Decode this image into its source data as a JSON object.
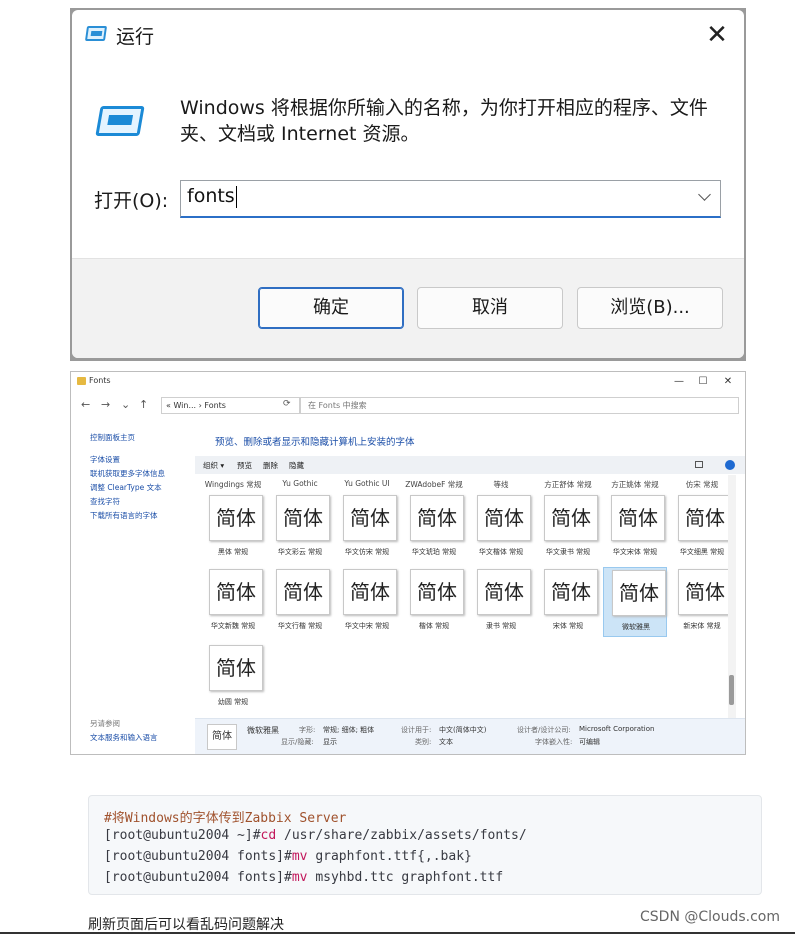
{
  "run_dialog": {
    "title": "运行",
    "close_glyph": "✕",
    "description": "Windows 将根据你所输入的名称，为你打开相应的程序、文件夹、文档或 Internet 资源。",
    "open_label": "打开(O):",
    "input_value": "fonts",
    "ok_label": "确定",
    "cancel_label": "取消",
    "browse_label": "浏览(B)...",
    "accent_color": "#2f6ec2"
  },
  "explorer": {
    "title": "Fonts",
    "window_buttons": [
      "—",
      "☐",
      "✕"
    ],
    "nav": {
      "back": "←",
      "forward": "→",
      "down": "⌄",
      "up": "↑",
      "refresh": "⟳"
    },
    "address": "« Win... › Fonts",
    "search_placeholder": "在 Fonts 中搜索",
    "left_links": [
      "控制面板主页",
      "字体设置",
      "联机获取更多字体信息",
      "调整 ClearType 文本",
      "查找字符",
      "下载所有语言的字体"
    ],
    "see_also": "另请参阅",
    "see_also_link": "文本服务和输入语言",
    "header": "预览、删除或者显示和隐藏计算机上安装的字体",
    "toolbar": {
      "organize": "组织 ▾",
      "preview": "预览",
      "delete": "删除",
      "hide": "隐藏"
    },
    "top_row_names": [
      "Wingdings 常规",
      "Yu Gothic",
      "Yu Gothic UI",
      "ZWAdobeF 常规",
      "等线",
      "方正舒体 常规",
      "方正姚体 常规",
      "仿宋 常规"
    ],
    "sample_text": "简体",
    "font_tiles": [
      "黑体 常规",
      "华文彩云 常规",
      "华文仿宋 常规",
      "华文琥珀 常规",
      "华文楷体 常规",
      "华文隶书 常规",
      "华文宋体 常规",
      "华文细黑 常规",
      "华文新魏 常规",
      "华文行楷 常规",
      "华文中宋 常规",
      "楷体 常规",
      "隶书 常规",
      "宋体 常规",
      "微软雅黑",
      "新宋体 常规",
      "幼圆 常规"
    ],
    "details": {
      "name": "微软雅黑",
      "style_key": "字形:",
      "style_val": "常规; 细体; 粗体",
      "show_key": "显示/隐藏:",
      "show_val": "显示",
      "design_key": "设计用于:",
      "design_val": "中文(简体中文)",
      "type_key": "类别:",
      "type_val": "文本",
      "designer_key": "设计者/设计公司:",
      "designer_val": "Microsoft Corporation",
      "embed_key": "字体嵌入性:",
      "embed_val": "可编辑"
    }
  },
  "code": {
    "comment": "#将Windows的字体传到Zabbix Server",
    "line1_prompt": "[root@ubuntu2004 ~]#",
    "line1_cmd": "cd",
    "line1_rest": " /usr/share/zabbix/assets/fonts/",
    "line2_prompt": "[root@ubuntu2004 fonts]#",
    "line2_cmd": "mv",
    "line2_rest": " graphfont.ttf{,.bak}",
    "line3_prompt": "[root@ubuntu2004 fonts]#",
    "line3_cmd": "mv",
    "line3_rest": " msyhbd.ttc graphfont.ttf"
  },
  "footer_text": "刷新页面后可以看乱码问题解决",
  "watermark": "CSDN @Clouds.com"
}
